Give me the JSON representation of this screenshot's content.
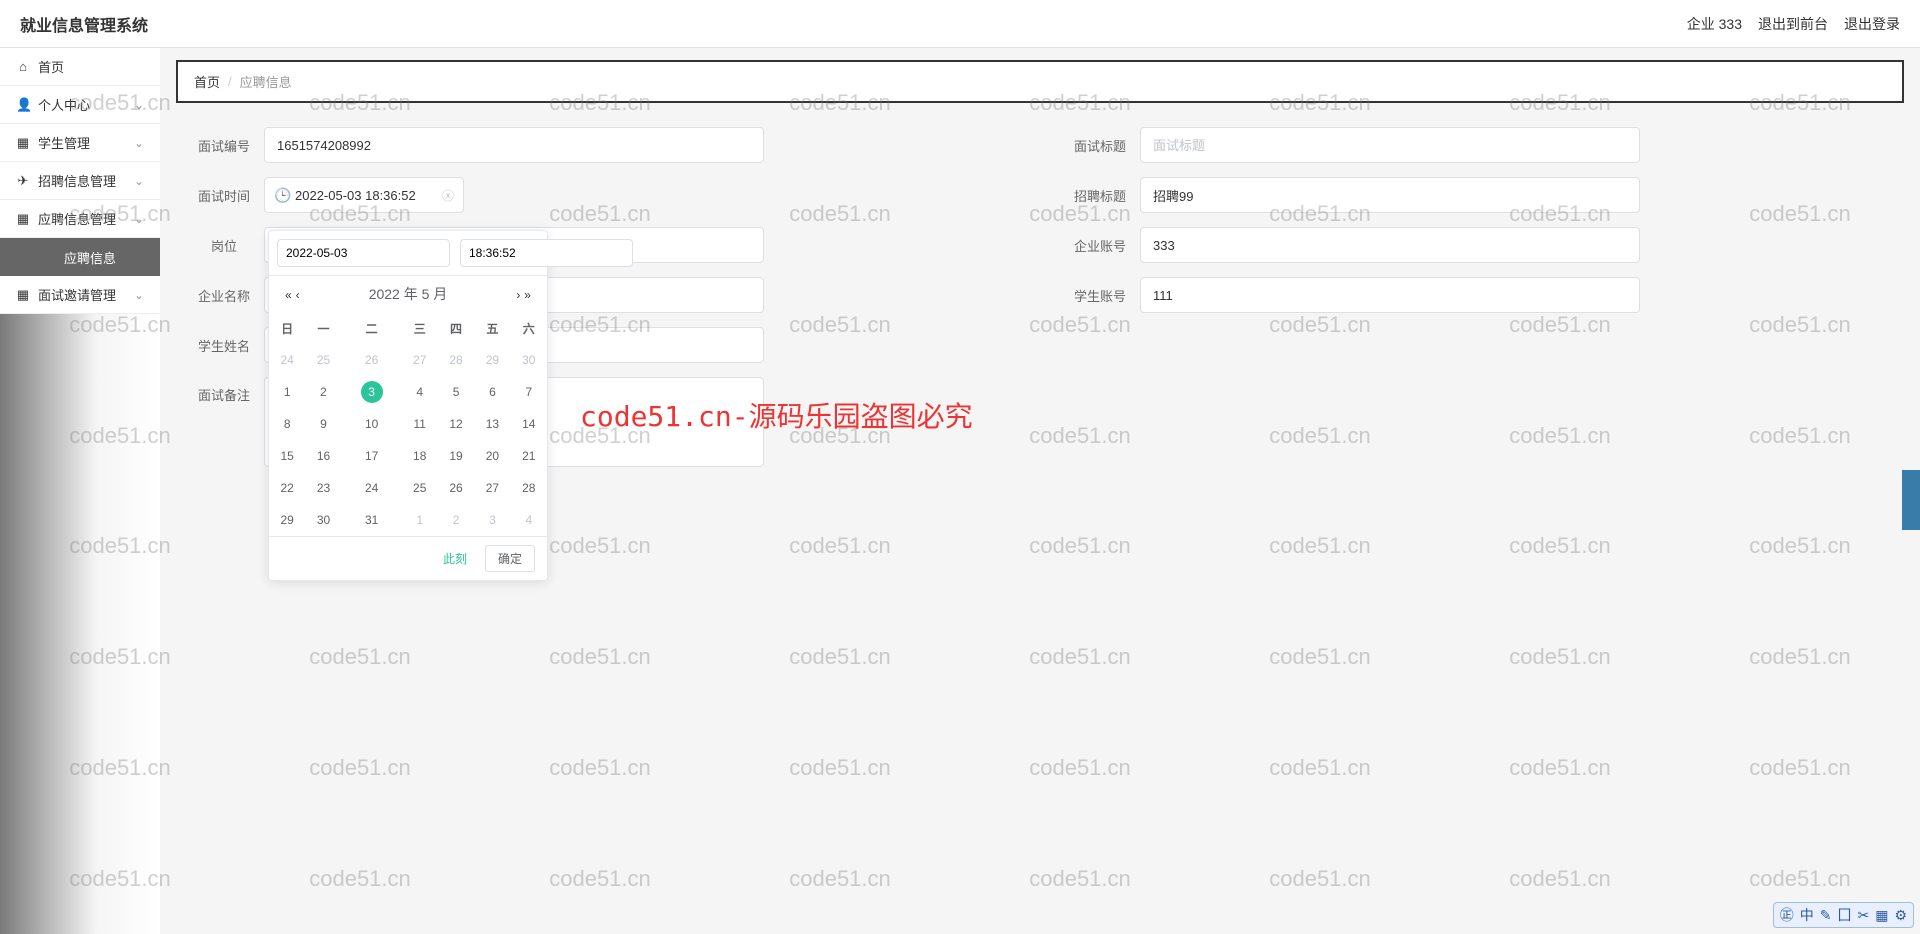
{
  "header": {
    "title": "就业信息管理系统",
    "user": "企业 333",
    "logout_front": "退出到前台",
    "logout": "退出登录"
  },
  "sidebar": {
    "items": [
      {
        "icon": "⌂",
        "label": "首页",
        "chev": false
      },
      {
        "icon": "👤",
        "label": "个人中心",
        "chev": true
      },
      {
        "icon": "▦",
        "label": "学生管理",
        "chev": true
      },
      {
        "icon": "✈",
        "label": "招聘信息管理",
        "chev": true
      },
      {
        "icon": "▦",
        "label": "应聘信息管理",
        "chev": true
      },
      {
        "icon": "",
        "label": "应聘信息",
        "chev": false,
        "active": true
      },
      {
        "icon": "▦",
        "label": "面试邀请管理",
        "chev": true
      }
    ]
  },
  "breadcrumb": {
    "home": "首页",
    "sep": "/",
    "current": "应聘信息"
  },
  "form": {
    "interview_id": {
      "label": "面试编号",
      "value": "1651574208992"
    },
    "interview_title": {
      "label": "面试标题",
      "placeholder": "面试标题"
    },
    "interview_time": {
      "label": "面试时间",
      "value": "2022-05-03 18:36:52"
    },
    "recruit_title": {
      "label": "招聘标题",
      "value": "招聘99"
    },
    "position": {
      "label": "岗位"
    },
    "company_account": {
      "label": "企业账号",
      "value": "333"
    },
    "company_name": {
      "label": "企业名称"
    },
    "student_account": {
      "label": "学生账号",
      "value": "111"
    },
    "student_name": {
      "label": "学生姓名"
    },
    "interview_note": {
      "label": "面试备注"
    }
  },
  "datepicker": {
    "date_input": "2022-05-03",
    "time_input": "18:36:52",
    "year_month": "2022 年  5 月",
    "weekdays": [
      "日",
      "一",
      "二",
      "三",
      "四",
      "五",
      "六"
    ],
    "weeks": [
      [
        {
          "d": "24",
          "o": true
        },
        {
          "d": "25",
          "o": true
        },
        {
          "d": "26",
          "o": true
        },
        {
          "d": "27",
          "o": true
        },
        {
          "d": "28",
          "o": true
        },
        {
          "d": "29",
          "o": true
        },
        {
          "d": "30",
          "o": true
        }
      ],
      [
        {
          "d": "1"
        },
        {
          "d": "2"
        },
        {
          "d": "3",
          "sel": true
        },
        {
          "d": "4"
        },
        {
          "d": "5"
        },
        {
          "d": "6"
        },
        {
          "d": "7"
        }
      ],
      [
        {
          "d": "8"
        },
        {
          "d": "9"
        },
        {
          "d": "10"
        },
        {
          "d": "11"
        },
        {
          "d": "12"
        },
        {
          "d": "13"
        },
        {
          "d": "14"
        }
      ],
      [
        {
          "d": "15"
        },
        {
          "d": "16"
        },
        {
          "d": "17"
        },
        {
          "d": "18"
        },
        {
          "d": "19"
        },
        {
          "d": "20"
        },
        {
          "d": "21"
        }
      ],
      [
        {
          "d": "22"
        },
        {
          "d": "23"
        },
        {
          "d": "24"
        },
        {
          "d": "25"
        },
        {
          "d": "26"
        },
        {
          "d": "27"
        },
        {
          "d": "28"
        }
      ],
      [
        {
          "d": "29"
        },
        {
          "d": "30"
        },
        {
          "d": "31"
        },
        {
          "d": "1",
          "o": true
        },
        {
          "d": "2",
          "o": true
        },
        {
          "d": "3",
          "o": true
        },
        {
          "d": "4",
          "o": true
        }
      ]
    ],
    "now": "此刻",
    "ok": "确定"
  },
  "watermark": {
    "text": "code51.cn",
    "center": "code51.cn-源码乐园盗图必究"
  },
  "ime": {
    "items": [
      "㊣",
      "中",
      "✎",
      "囗",
      "✂",
      "▦",
      "⚙"
    ]
  }
}
